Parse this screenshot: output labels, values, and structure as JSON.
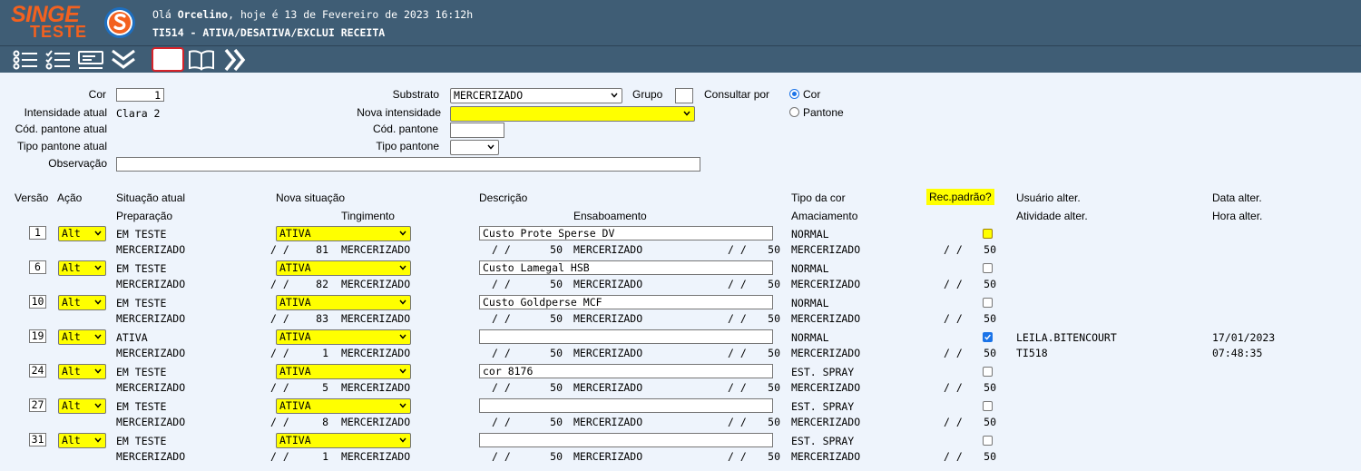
{
  "header": {
    "logo_top": "SINGE",
    "logo_bottom": "TESTE",
    "greeting_prefix": "Olá",
    "user": "Orcelino",
    "greeting_suffix": ", hoje é 13 de Fevereiro de 2023 16:12h",
    "title": "TI514 - ATIVA/DESATIVA/EXCLUI RECEITA"
  },
  "toolbar": {
    "icons": [
      "list-checks-icon",
      "list-checks-2-icon",
      "card-icon",
      "double-chevron-down-icon",
      "refresh-icon",
      "book-icon",
      "double-chevron-right-icon"
    ]
  },
  "form": {
    "cor_label": "Cor",
    "cor_value": "1",
    "intensidade_atual_label": "Intensidade atual",
    "intensidade_atual_value": "Clara 2",
    "cod_pantone_atual_label": "Cód. pantone atual",
    "tipo_pantone_atual_label": "Tipo pantone atual",
    "observacao_label": "Observação",
    "observacao_value": "",
    "substrato_label": "Substrato",
    "substrato_value": "MERCERIZADO",
    "grupo_label": "Grupo",
    "grupo_value": "",
    "consultar_por_label": "Consultar por",
    "radio_cor": "Cor",
    "radio_pantone": "Pantone",
    "nova_intensidade_label": "Nova intensidade",
    "nova_intensidade_value": "",
    "cod_pantone_label": "Cód. pantone",
    "cod_pantone_value": "",
    "tipo_pantone_label": "Tipo pantone",
    "tipo_pantone_value": ""
  },
  "table": {
    "headers": {
      "versao": "Versão",
      "acao": "Ação",
      "situacao_atual": "Situação atual",
      "nova_situacao": "Nova situação",
      "descricao": "Descrição",
      "tipo_da_cor": "Tipo da cor",
      "rec_padrao": "Rec.padrão?",
      "usuario_alter": "Usuário alter.",
      "data_alter": "Data alter.",
      "preparacao": "Preparação",
      "tingimento": "Tingimento",
      "ensaboamento": "Ensaboamento",
      "amaciamento": "Amaciamento",
      "atividade_alter": "Atividade alter.",
      "hora_alter": "Hora alter."
    },
    "rows": [
      {
        "versao": "1",
        "acao": "Alt",
        "situacao_atual": "EM TESTE",
        "nova_situacao": "ATIVA",
        "descricao": "Custo Prote Sperse DV",
        "tipo_da_cor": "NORMAL",
        "rec_padrao": false,
        "rec_highlight": true,
        "preparacao": "MERCERIZADO",
        "ting_slash": "/   /",
        "ting_num": "81",
        "ting_sub": "MERCERIZADO",
        "ens_slash": "/   /",
        "ens_num": "50",
        "ens_sub": "MERCERIZADO",
        "ens2_slash": "/   /",
        "ens2_num": "50",
        "amac_sub": "MERCERIZADO",
        "amac_slash": "/   /",
        "amac_num": "50",
        "usuario": "",
        "atividade": "",
        "data": "",
        "hora": ""
      },
      {
        "versao": "6",
        "acao": "Alt",
        "situacao_atual": "EM TESTE",
        "nova_situacao": "ATIVA",
        "descricao": "Custo Lamegal HSB",
        "tipo_da_cor": "NORMAL",
        "rec_padrao": false,
        "rec_highlight": false,
        "preparacao": "MERCERIZADO",
        "ting_slash": "/   /",
        "ting_num": "82",
        "ting_sub": "MERCERIZADO",
        "ens_slash": "/   /",
        "ens_num": "50",
        "ens_sub": "MERCERIZADO",
        "ens2_slash": "/   /",
        "ens2_num": "50",
        "amac_sub": "MERCERIZADO",
        "amac_slash": "/   /",
        "amac_num": "50",
        "usuario": "",
        "atividade": "",
        "data": "",
        "hora": ""
      },
      {
        "versao": "10",
        "acao": "Alt",
        "situacao_atual": "EM TESTE",
        "nova_situacao": "ATIVA",
        "descricao": "Custo Goldperse MCF",
        "tipo_da_cor": "NORMAL",
        "rec_padrao": false,
        "rec_highlight": false,
        "preparacao": "MERCERIZADO",
        "ting_slash": "/   /",
        "ting_num": "83",
        "ting_sub": "MERCERIZADO",
        "ens_slash": "/   /",
        "ens_num": "50",
        "ens_sub": "MERCERIZADO",
        "ens2_slash": "/   /",
        "ens2_num": "50",
        "amac_sub": "MERCERIZADO",
        "amac_slash": "/   /",
        "amac_num": "50",
        "usuario": "",
        "atividade": "",
        "data": "",
        "hora": ""
      },
      {
        "versao": "19",
        "acao": "Alt",
        "situacao_atual": "ATIVA",
        "nova_situacao": "ATIVA",
        "descricao": "",
        "tipo_da_cor": "NORMAL",
        "rec_padrao": true,
        "rec_highlight": false,
        "preparacao": "MERCERIZADO",
        "ting_slash": "/   /",
        "ting_num": "1",
        "ting_sub": "MERCERIZADO",
        "ens_slash": "/   /",
        "ens_num": "50",
        "ens_sub": "MERCERIZADO",
        "ens2_slash": "/   /",
        "ens2_num": "50",
        "amac_sub": "MERCERIZADO",
        "amac_slash": "/   /",
        "amac_num": "50",
        "usuario": "LEILA.BITENCOURT",
        "atividade": "TI518",
        "data": "17/01/2023",
        "hora": "07:48:35"
      },
      {
        "versao": "24",
        "acao": "Alt",
        "situacao_atual": "EM TESTE",
        "nova_situacao": "ATIVA",
        "descricao": "cor 8176",
        "tipo_da_cor": "EST. SPRAY",
        "rec_padrao": false,
        "rec_highlight": false,
        "preparacao": "MERCERIZADO",
        "ting_slash": "/   /",
        "ting_num": "5",
        "ting_sub": "MERCERIZADO",
        "ens_slash": "/   /",
        "ens_num": "50",
        "ens_sub": "MERCERIZADO",
        "ens2_slash": "/   /",
        "ens2_num": "50",
        "amac_sub": "MERCERIZADO",
        "amac_slash": "/   /",
        "amac_num": "50",
        "usuario": "",
        "atividade": "",
        "data": "",
        "hora": ""
      },
      {
        "versao": "27",
        "acao": "Alt",
        "situacao_atual": "EM TESTE",
        "nova_situacao": "ATIVA",
        "descricao": "",
        "tipo_da_cor": "EST. SPRAY",
        "rec_padrao": false,
        "rec_highlight": false,
        "preparacao": "MERCERIZADO",
        "ting_slash": "/   /",
        "ting_num": "8",
        "ting_sub": "MERCERIZADO",
        "ens_slash": "/   /",
        "ens_num": "50",
        "ens_sub": "MERCERIZADO",
        "ens2_slash": "/   /",
        "ens2_num": "50",
        "amac_sub": "MERCERIZADO",
        "amac_slash": "/   /",
        "amac_num": "50",
        "usuario": "",
        "atividade": "",
        "data": "",
        "hora": ""
      },
      {
        "versao": "31",
        "acao": "Alt",
        "situacao_atual": "EM TESTE",
        "nova_situacao": "ATIVA",
        "descricao": "",
        "tipo_da_cor": "EST. SPRAY",
        "rec_padrao": false,
        "rec_highlight": false,
        "preparacao": "MERCERIZADO",
        "ting_slash": "/   /",
        "ting_num": "1",
        "ting_sub": "MERCERIZADO",
        "ens_slash": "/   /",
        "ens_num": "50",
        "ens_sub": "MERCERIZADO",
        "ens2_slash": "/   /",
        "ens2_num": "50",
        "amac_sub": "MERCERIZADO",
        "amac_slash": "/   /",
        "amac_num": "50",
        "usuario": "",
        "atividade": "",
        "data": "",
        "hora": ""
      }
    ]
  },
  "colors": {
    "header_bg": "#3f5d75",
    "logo": "#f3611f",
    "highlight": "#ffff00",
    "accent": "#1a73e8",
    "page_bg": "#eef4fc"
  }
}
